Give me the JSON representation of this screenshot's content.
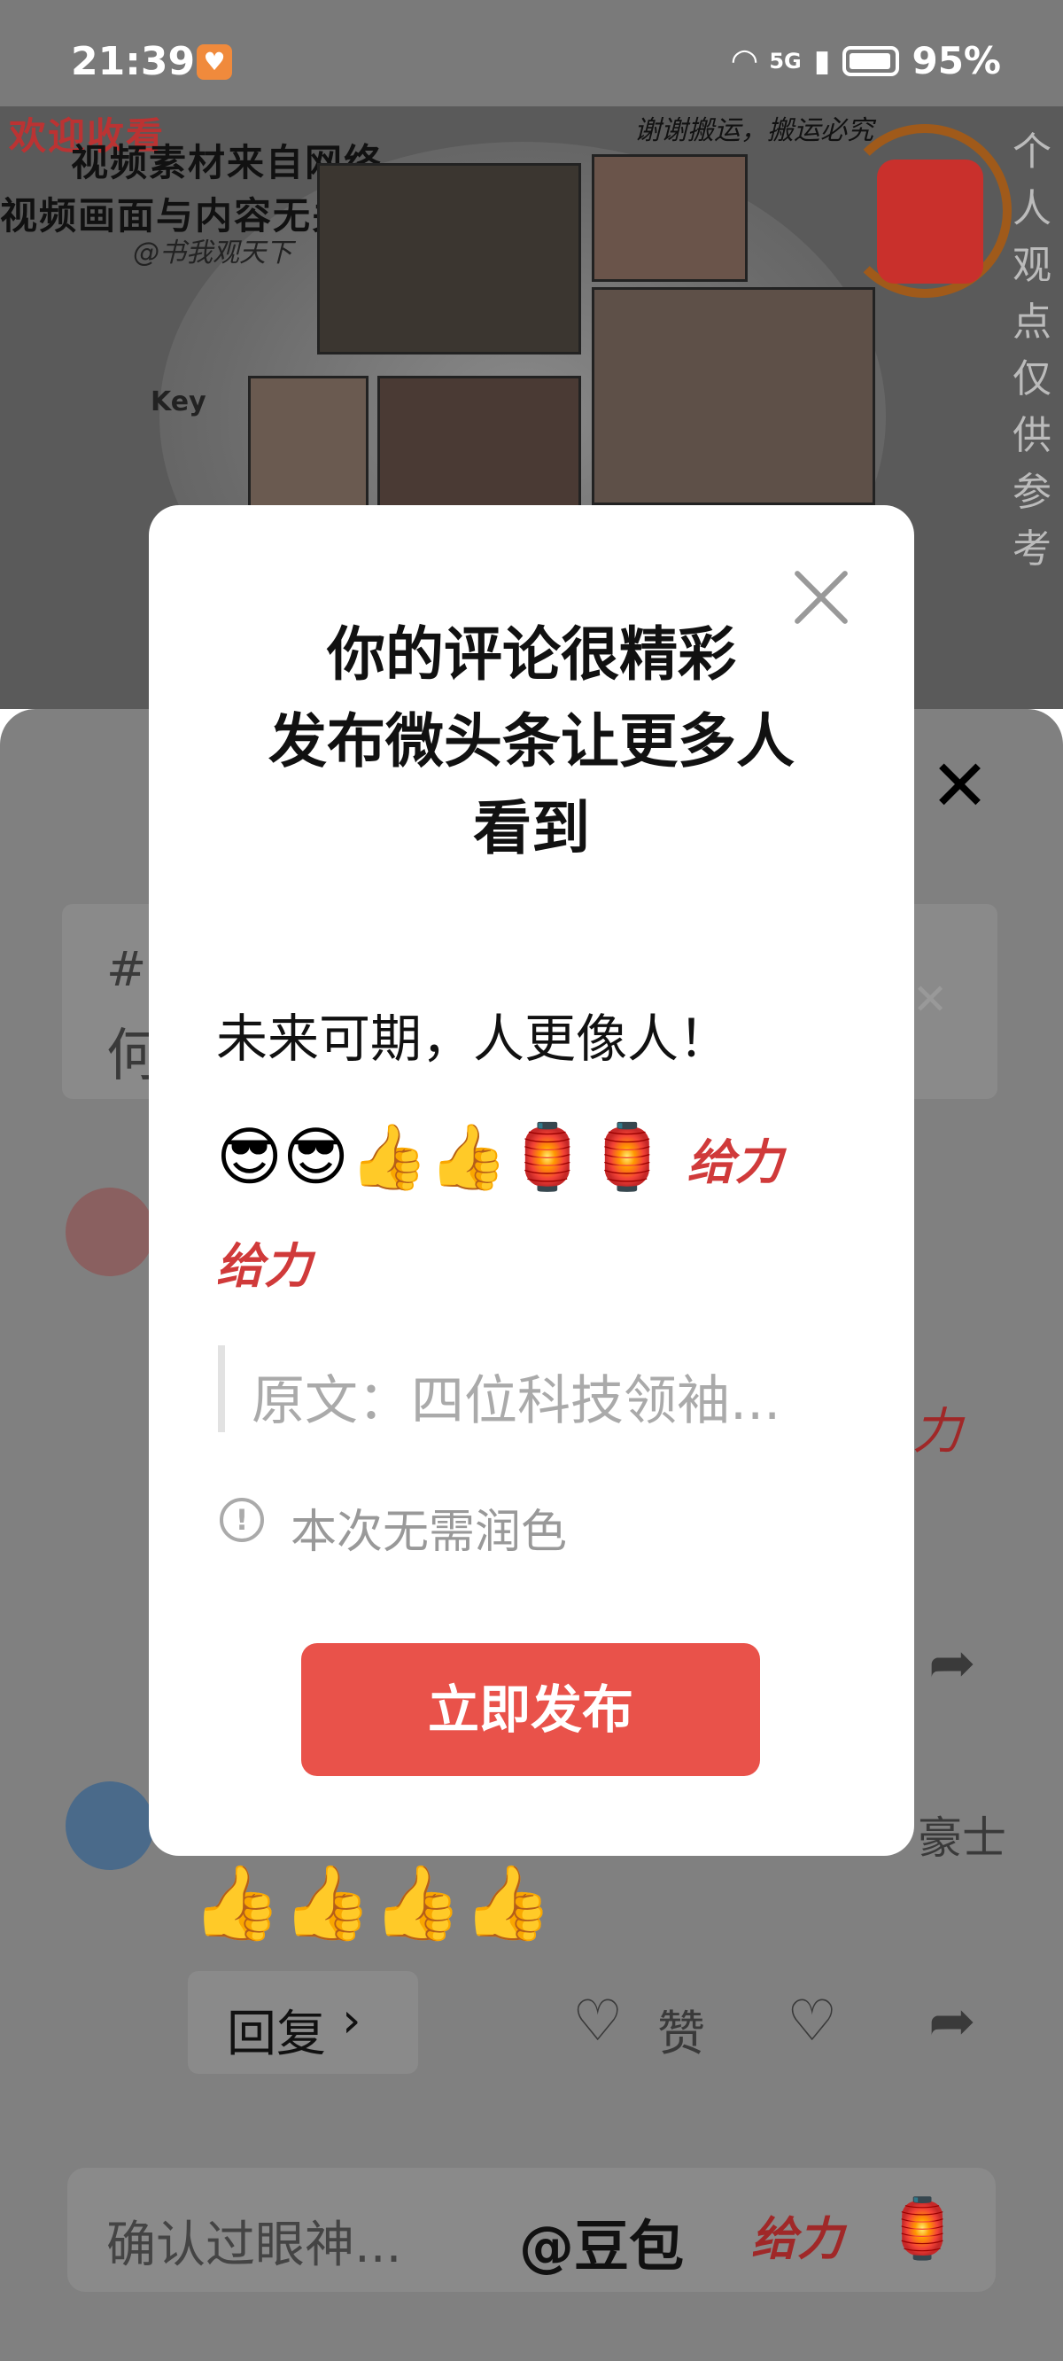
{
  "status_bar": {
    "time": "21:39",
    "network": "5G",
    "battery": "95%"
  },
  "video": {
    "overlay_line1": "欢迎收看",
    "overlay_line2": "视频素材来自网络",
    "overlay_line3": "视频画面与内容无关",
    "watermark": "@书我观天下",
    "top_caption": "谢谢搬运，搬运必究",
    "label_key": "Key",
    "side_caption": [
      "个",
      "人",
      "观",
      "点",
      "仅",
      "供",
      "参",
      "考"
    ]
  },
  "sheet": {
    "partial_left_1": "何",
    "bottom_emojis": "👍👍👍👍",
    "reply_label": "回复",
    "like_label": "赞",
    "input_placeholder": "确认过眼神...",
    "mention": "@豆包"
  },
  "modal": {
    "title_line1": "你的评论很精彩",
    "title_line2": "发布微头条让更多人",
    "title_line3": "看到",
    "comment_text": "未来可期，人更像人！",
    "emojis": "😎😎👍👍🏮🏮",
    "sticker_label": "给力",
    "original_text": "原文：四位科技领袖...",
    "info_text": "本次无需润色",
    "publish_button": "立即发布"
  },
  "colors": {
    "publish_button": "#e9524a",
    "dim_overlay": "#808080"
  }
}
